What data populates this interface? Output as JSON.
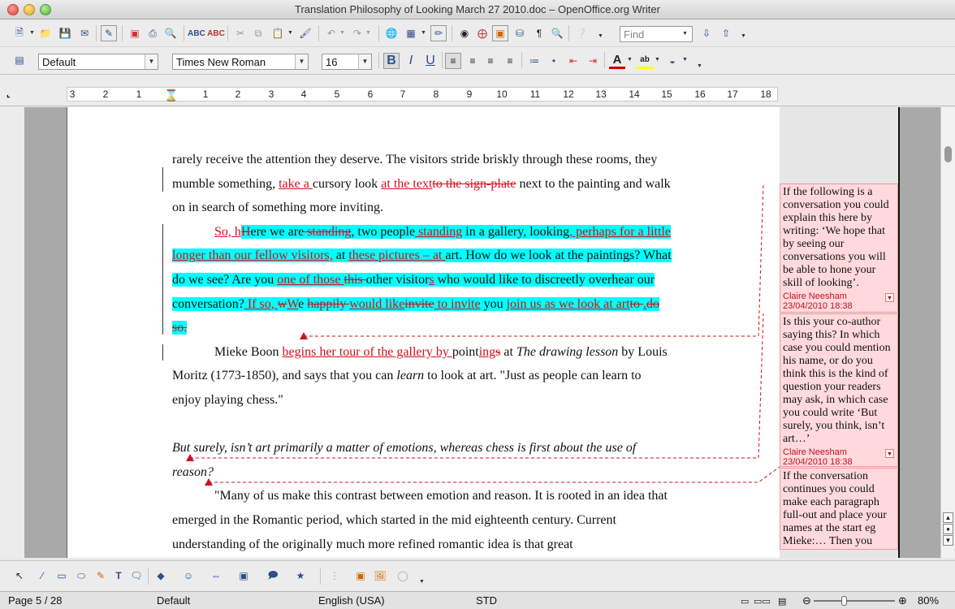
{
  "window": {
    "title": "Translation Philosophy of Looking March 27 2010.doc – OpenOffice.org Writer"
  },
  "toolbar": {
    "find_placeholder": "Find",
    "paragraph_style": "Default",
    "font_name": "Times New Roman",
    "font_size": "16",
    "bold_label": "B",
    "italic_label": "I",
    "underline_label": "U"
  },
  "ruler": {
    "labels": [
      "3",
      "2",
      "1",
      "1",
      "2",
      "3",
      "4",
      "5",
      "6",
      "7",
      "8",
      "9",
      "10",
      "11",
      "12",
      "13",
      "14",
      "15",
      "16",
      "17",
      "18"
    ]
  },
  "document": {
    "p1": {
      "t1": "rarely receive the attention they deserve. The visitors stride briskly through these rooms, they mumble something, ",
      "ins1": "take a ",
      "t2": "cursory look ",
      "ins2": "at the text",
      "del1": "to the sign-plate",
      "t3": " next to the painting and walk on in search of something more inviting."
    },
    "p2": {
      "ins1": "So, h",
      "del1": "H",
      "t1": "ere we are",
      "del2": " standing",
      "t2": ", two people",
      "ins2": " standing",
      "t3": " in a gallery, looking",
      "ins3": ", perhaps for a little longer than our fellow visitors,",
      "t4": " at ",
      "ins4": "these pictures – at ",
      "t5": "art. How do we look at the paintings? What do we see? Are you ",
      "ins5": "one of those ",
      "del3": "this ",
      "t6": "other visitor",
      "ins6": "s",
      "t7": " who would like to discreetly overhear our conversation?",
      "ins7": " If so, ",
      "del4": " w",
      "ins8": "W",
      "t8": "e ",
      "del5": "happily ",
      "ins9": "would like",
      "del6": "invite",
      "ins10": " to invite",
      "t9": " you ",
      "ins11": "join us as we look at art",
      "del7": "to ",
      "ins12": ".",
      "del8": "do so."
    },
    "p3": {
      "t1": "Mieke Boon ",
      "ins1": "begins her tour of the gallery by ",
      "t2": "point",
      "ins2": "ing",
      "del1": "s",
      "t3": " at ",
      "it1": "The drawing lesson",
      "t4": " by Louis Moritz (1773-1850), and says that you can ",
      "it2": "learn",
      "t5": " to look at art. \"Just as people can learn to enjoy playing chess.\""
    },
    "p4": "But surely, isn’t art primarily a matter of emotions, whereas chess is first about the use of reason?",
    "p5": "\"Many of us make this contrast between emotion and reason. It is rooted in an idea that emerged in the Romantic period, which started in the mid eighteenth century. Current understanding of the originally much more refined romantic idea is that great"
  },
  "comments": [
    {
      "text": "If the following is a conversation you could explain this here by writing: ‘We hope that by seeing our conversations you will be able to hone your skill of looking’.",
      "author": "Claire Neesham",
      "date": "23/04/2010 18:38"
    },
    {
      "text": "Is this your co-author saying this? In which case you could mention his name, or do you think this is the kind of question your readers may ask, in which case you could write ‘But surely, you think, isn’t art…’",
      "author": "Claire Neesham",
      "date": "23/04/2010 18:38"
    },
    {
      "text": "If the conversation continues you could make each paragraph full-out and place your names at the start eg Mieke:… Then you"
    }
  ],
  "status": {
    "page": "Page 5 / 28",
    "style": "Default",
    "language": "English (USA)",
    "mode": "STD",
    "zoom": "80%"
  },
  "colors": {
    "highlight": "#00ffff",
    "track_change": "#d01020",
    "comment_bg": "#ffd9dc"
  }
}
